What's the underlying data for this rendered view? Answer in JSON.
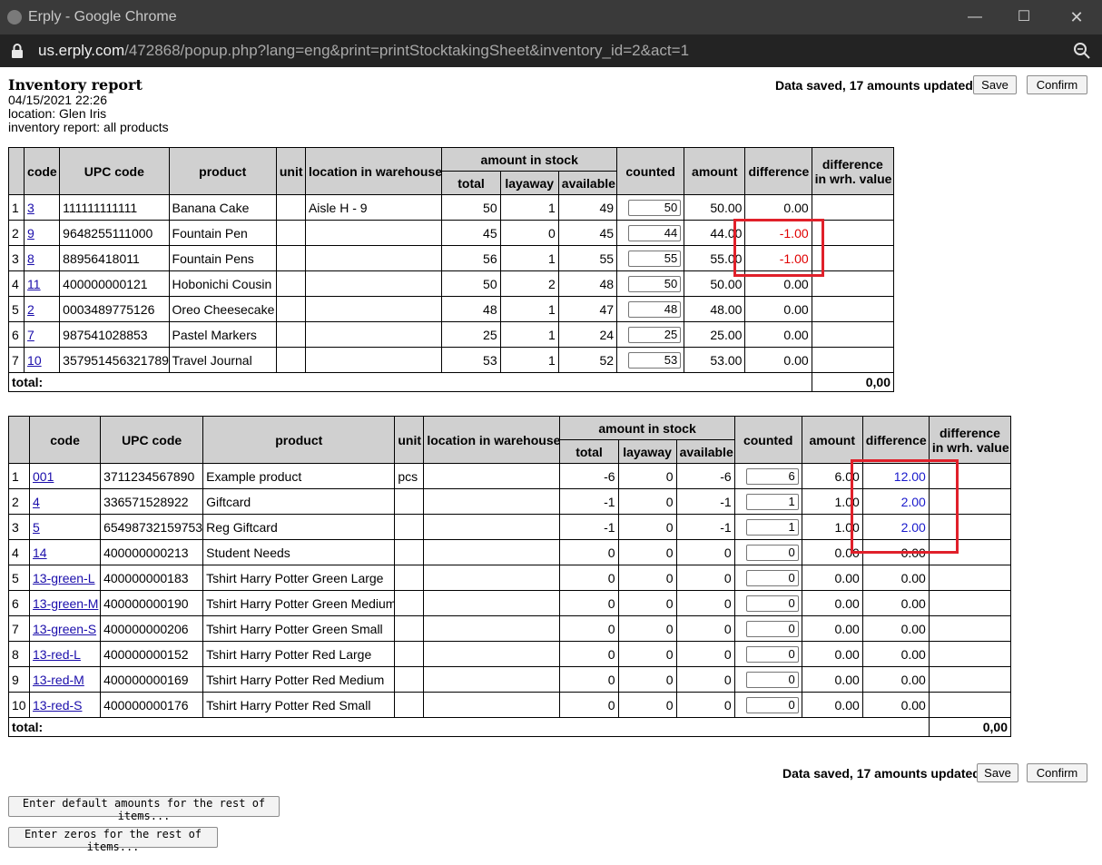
{
  "window": {
    "title": "Erply - Google Chrome",
    "minimize": "—",
    "maximize": "☐",
    "close": "✕"
  },
  "address": {
    "host": "us.erply.com",
    "path": "/472868/popup.php?lang=eng&print=printStocktakingSheet&inventory_id=2&act=1"
  },
  "report": {
    "title": "Inventory report",
    "datetime": "04/15/2021 22:26",
    "location": "location: Glen Iris",
    "scope": "inventory report: all products"
  },
  "status_text": "Data saved, 17 amounts updated.",
  "buttons": {
    "save": "Save",
    "confirm": "Confirm",
    "enter_defaults": "Enter default amounts for the rest of items...",
    "enter_zeros": "Enter zeros for the rest of items..."
  },
  "headers": {
    "code": "code",
    "upc": "UPC code",
    "product": "product",
    "unit": "unit",
    "location": "location in warehouse",
    "amount_in_stock": "amount in stock",
    "total": "total",
    "layaway": "layaway",
    "available": "available",
    "counted": "counted",
    "amount": "amount",
    "difference": "difference",
    "diff_value_1": "difference",
    "diff_value_2": "in wrh. value",
    "total_row": "total:"
  },
  "table1": {
    "total_value": "0,00",
    "rows": [
      {
        "n": "1",
        "code": "3",
        "upc": "111111111111",
        "product": "Banana Cake",
        "unit": "",
        "loc": "Aisle H - 9",
        "total": "50",
        "layaway": "1",
        "available": "49",
        "counted": "50",
        "amount": "50.00",
        "difference": "0.00",
        "dv": ""
      },
      {
        "n": "2",
        "code": "9",
        "upc": "9648255111000",
        "product": "Fountain Pen",
        "unit": "",
        "loc": "",
        "total": "45",
        "layaway": "0",
        "available": "45",
        "counted": "44",
        "amount": "44.00",
        "difference": "-1.00",
        "dv": ""
      },
      {
        "n": "3",
        "code": "8",
        "upc": "88956418011",
        "product": "Fountain Pens",
        "unit": "",
        "loc": "",
        "total": "56",
        "layaway": "1",
        "available": "55",
        "counted": "55",
        "amount": "55.00",
        "difference": "-1.00",
        "dv": ""
      },
      {
        "n": "4",
        "code": "11",
        "upc": "400000000121",
        "product": "Hobonichi Cousin",
        "unit": "",
        "loc": "",
        "total": "50",
        "layaway": "2",
        "available": "48",
        "counted": "50",
        "amount": "50.00",
        "difference": "0.00",
        "dv": ""
      },
      {
        "n": "5",
        "code": "2",
        "upc": "0003489775126",
        "product": "Oreo Cheesecake",
        "unit": "",
        "loc": "",
        "total": "48",
        "layaway": "1",
        "available": "47",
        "counted": "48",
        "amount": "48.00",
        "difference": "0.00",
        "dv": ""
      },
      {
        "n": "6",
        "code": "7",
        "upc": "987541028853",
        "product": "Pastel Markers",
        "unit": "",
        "loc": "",
        "total": "25",
        "layaway": "1",
        "available": "24",
        "counted": "25",
        "amount": "25.00",
        "difference": "0.00",
        "dv": ""
      },
      {
        "n": "7",
        "code": "10",
        "upc": "357951456321789",
        "product": "Travel Journal",
        "unit": "",
        "loc": "",
        "total": "53",
        "layaway": "1",
        "available": "52",
        "counted": "53",
        "amount": "53.00",
        "difference": "0.00",
        "dv": ""
      }
    ]
  },
  "table2": {
    "total_value": "0,00",
    "rows": [
      {
        "n": "1",
        "code": "001",
        "upc": "3711234567890",
        "product": "Example product",
        "unit": "pcs",
        "loc": "",
        "total": "-6",
        "layaway": "0",
        "available": "-6",
        "counted": "6",
        "amount": "6.00",
        "difference": "12.00",
        "dv": ""
      },
      {
        "n": "2",
        "code": "4",
        "upc": "336571528922",
        "product": "Giftcard",
        "unit": "",
        "loc": "",
        "total": "-1",
        "layaway": "0",
        "available": "-1",
        "counted": "1",
        "amount": "1.00",
        "difference": "2.00",
        "dv": ""
      },
      {
        "n": "3",
        "code": "5",
        "upc": "65498732159753",
        "product": "Reg Giftcard",
        "unit": "",
        "loc": "",
        "total": "-1",
        "layaway": "0",
        "available": "-1",
        "counted": "1",
        "amount": "1.00",
        "difference": "2.00",
        "dv": ""
      },
      {
        "n": "4",
        "code": "14",
        "upc": "400000000213",
        "product": "Student Needs",
        "unit": "",
        "loc": "",
        "total": "0",
        "layaway": "0",
        "available": "0",
        "counted": "0",
        "amount": "0.00",
        "difference": "0.00",
        "dv": ""
      },
      {
        "n": "5",
        "code": "13-green-L",
        "upc": "400000000183",
        "product": "Tshirt Harry Potter Green Large",
        "unit": "",
        "loc": "",
        "total": "0",
        "layaway": "0",
        "available": "0",
        "counted": "0",
        "amount": "0.00",
        "difference": "0.00",
        "dv": ""
      },
      {
        "n": "6",
        "code": "13-green-M",
        "upc": "400000000190",
        "product": "Tshirt Harry Potter Green Medium",
        "unit": "",
        "loc": "",
        "total": "0",
        "layaway": "0",
        "available": "0",
        "counted": "0",
        "amount": "0.00",
        "difference": "0.00",
        "dv": ""
      },
      {
        "n": "7",
        "code": "13-green-S",
        "upc": "400000000206",
        "product": "Tshirt Harry Potter Green Small",
        "unit": "",
        "loc": "",
        "total": "0",
        "layaway": "0",
        "available": "0",
        "counted": "0",
        "amount": "0.00",
        "difference": "0.00",
        "dv": ""
      },
      {
        "n": "8",
        "code": "13-red-L",
        "upc": "400000000152",
        "product": "Tshirt Harry Potter Red Large",
        "unit": "",
        "loc": "",
        "total": "0",
        "layaway": "0",
        "available": "0",
        "counted": "0",
        "amount": "0.00",
        "difference": "0.00",
        "dv": ""
      },
      {
        "n": "9",
        "code": "13-red-M",
        "upc": "400000000169",
        "product": "Tshirt Harry Potter Red Medium",
        "unit": "",
        "loc": "",
        "total": "0",
        "layaway": "0",
        "available": "0",
        "counted": "0",
        "amount": "0.00",
        "difference": "0.00",
        "dv": ""
      },
      {
        "n": "10",
        "code": "13-red-S",
        "upc": "400000000176",
        "product": "Tshirt Harry Potter Red Small",
        "unit": "",
        "loc": "",
        "total": "0",
        "layaway": "0",
        "available": "0",
        "counted": "0",
        "amount": "0.00",
        "difference": "0.00",
        "dv": ""
      }
    ]
  },
  "colors": {
    "negative": "#e00000",
    "positive": "#1a1acc",
    "link": "#1a0dab",
    "highlight": "#e0202a",
    "header_bg": "#d0d0d0"
  }
}
